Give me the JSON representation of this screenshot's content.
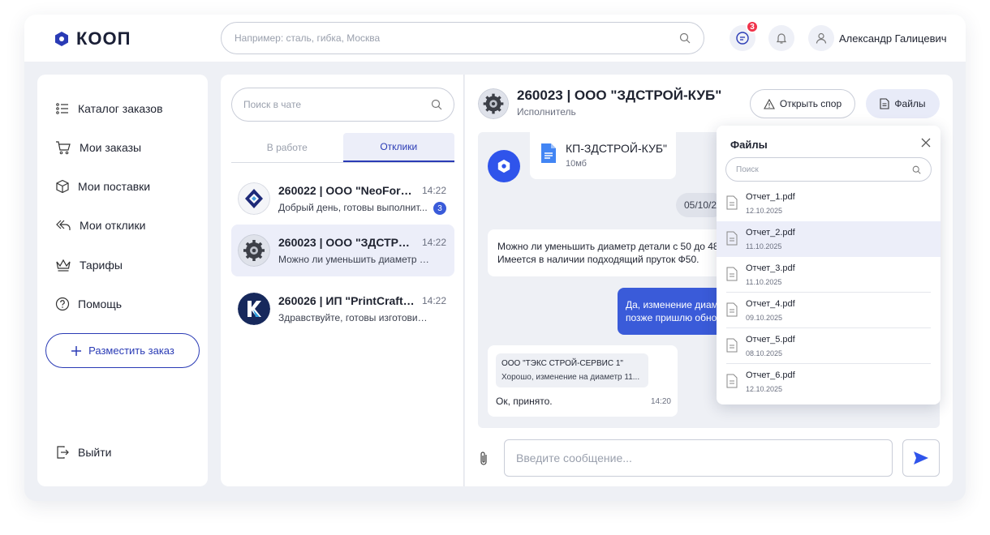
{
  "header": {
    "logo_text": "КООП",
    "search_placeholder": "Например: сталь, гибка, Москва",
    "chat_badge": "3",
    "user_name": "Александр Галицевич"
  },
  "sidebar": {
    "items": [
      {
        "label": "Каталог заказов",
        "icon": "catalog-list-icon"
      },
      {
        "label": "Мои заказы",
        "icon": "cart-icon"
      },
      {
        "label": "Мои поставки",
        "icon": "box-icon"
      },
      {
        "label": "Мои отклики",
        "icon": "reply-all-icon"
      },
      {
        "label": "Тарифы",
        "icon": "crown-icon"
      },
      {
        "label": "Помощь",
        "icon": "help-icon"
      }
    ],
    "place_order": "Разместить заказ",
    "logout": "Выйти"
  },
  "chatlist": {
    "search_placeholder": "Поиск в чате",
    "tabs": [
      "В работе",
      "Отклики"
    ],
    "active_tab": 1,
    "items": [
      {
        "title": "260022 | ООО \"NeoForm...",
        "time": "14:22",
        "message": "Добрый день, готовы выполнит...",
        "badge": "3"
      },
      {
        "title": "260023 | ООО \"ЗДСТРО...",
        "time": "14:22",
        "message": "Можно ли уменьшить диаметр дет..."
      },
      {
        "title": "260026 | ИП \"PrintCraft Т...",
        "time": "14:22",
        "message": "Здравствуйте, готовы изготовить в..."
      }
    ]
  },
  "chat": {
    "title": "260023 | ООО \"ЗДСТРОЙ-КУБ\"",
    "subtitle": "Исполнитель",
    "dispute_label": "Открыть спор",
    "files_label": "Файлы",
    "file_message": {
      "name": "КП-ЗДСТРОЙ-КУБ\"",
      "size": "10мб"
    },
    "date_chip": "05/10/2",
    "incoming_1": {
      "line1": "Можно ли уменьшить диаметр детали с 50 до 48",
      "line2": "Имеется в наличии подходящий пруток Ф50."
    },
    "outgoing_1": {
      "line1": "Да, изменение диам",
      "line2": "позже пришлю обно"
    },
    "incoming_2": {
      "quote_author": "ООО \"ТЭКС СТРОЙ-СЕРВИС 1\"",
      "quote_text": "Хорошо, изменение на диаметр 11...",
      "text": "Ок, принято.",
      "time": "14:20"
    },
    "composer_placeholder": "Введите сообщение..."
  },
  "files_popup": {
    "title": "Файлы",
    "search_placeholder": "Поиск",
    "selected": 1,
    "files": [
      {
        "name": "Отчет_1.pdf",
        "date": "12.10.2025"
      },
      {
        "name": "Отчет_2.pdf",
        "date": "11.10.2025"
      },
      {
        "name": "Отчет_3.pdf",
        "date": "11.10.2025"
      },
      {
        "name": "Отчет_4.pdf",
        "date": "09.10.2025"
      },
      {
        "name": "Отчет_5.pdf",
        "date": "08.10.2025"
      },
      {
        "name": "Отчет_6.pdf",
        "date": "12.10.2025"
      }
    ]
  },
  "colors": {
    "accent": "#2a3bb5",
    "accent_bright": "#2f54eb",
    "badge_red": "#f0334a",
    "outgoing_bubble": "#3a5bd9"
  }
}
